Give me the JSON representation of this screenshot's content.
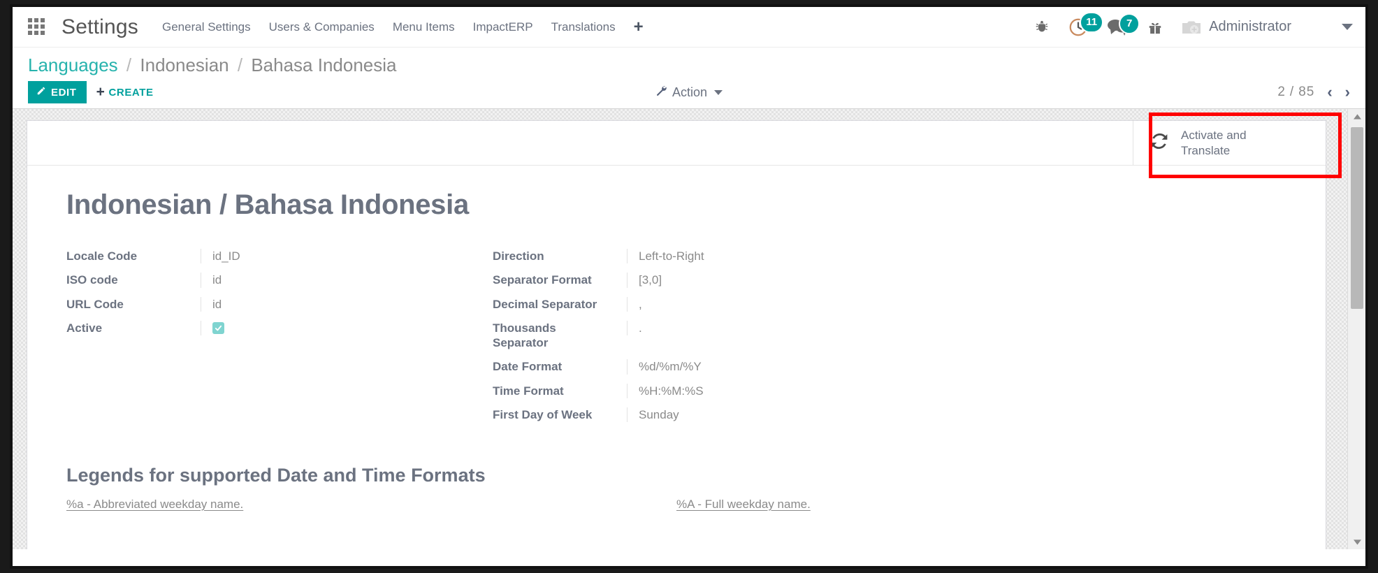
{
  "navbar": {
    "apps_icon": "apps-grid-icon",
    "brand": "Settings",
    "menu": [
      {
        "label": "General Settings"
      },
      {
        "label": "Users & Companies"
      },
      {
        "label": "Menu Items"
      },
      {
        "label": "ImpactERP"
      },
      {
        "label": "Translations"
      }
    ],
    "menu_plus": "+",
    "systray": [
      {
        "name": "bug-icon",
        "badge": null
      },
      {
        "name": "clock-icon",
        "badge": "11"
      },
      {
        "name": "chat-icon",
        "badge": "7"
      },
      {
        "name": "gift-icon",
        "badge": null
      }
    ],
    "user": {
      "avatar": "camera-avatar-icon",
      "name": "Administrator"
    }
  },
  "breadcrumb": {
    "root": "Languages",
    "sep": "/",
    "item": "Indonesian",
    "current": "Bahasa Indonesia"
  },
  "toolbar": {
    "edit_label": "EDIT",
    "create_label": "CREATE",
    "create_plus": "+",
    "action_label": "Action",
    "pager_current": "2",
    "pager_sep": "/",
    "pager_total": "85",
    "pager_prev": "‹",
    "pager_next": "›"
  },
  "sheet": {
    "activate_button": {
      "icon": "refresh-sync-icon",
      "label_line1": "Activate and",
      "label_line2": "Translate"
    },
    "record_title": "Indonesian / Bahasa Indonesia",
    "fields_left": [
      {
        "label": "Locale Code",
        "value": "id_ID",
        "type": "text"
      },
      {
        "label": "ISO code",
        "value": "id",
        "type": "text"
      },
      {
        "label": "URL Code",
        "value": "id",
        "type": "text"
      },
      {
        "label": "Active",
        "value": "",
        "type": "checkbox",
        "checked": true
      }
    ],
    "fields_right": [
      {
        "label": "Direction",
        "value": "Left-to-Right",
        "type": "text"
      },
      {
        "label": "Separator Format",
        "value": "[3,0]",
        "type": "text"
      },
      {
        "label": "Decimal Separator",
        "value": ",",
        "type": "text"
      },
      {
        "label": "Thousands Separator",
        "value": ".",
        "type": "text"
      },
      {
        "label": "Date Format",
        "value": "%d/%m/%Y",
        "type": "text"
      },
      {
        "label": "Time Format",
        "value": "%H:%M:%S",
        "type": "text"
      },
      {
        "label": "First Day of Week",
        "value": "Sunday",
        "type": "text"
      }
    ],
    "legend_title": "Legends for supported Date and Time Formats",
    "legend_left": "%a - Abbreviated weekday name.",
    "legend_right": "%A - Full weekday name."
  },
  "colors": {
    "accent": "#00a09d",
    "badge": "#00a09d",
    "highlight": "#ff0000",
    "label_text": "#6b7280",
    "value_text": "#8a8a8a"
  }
}
